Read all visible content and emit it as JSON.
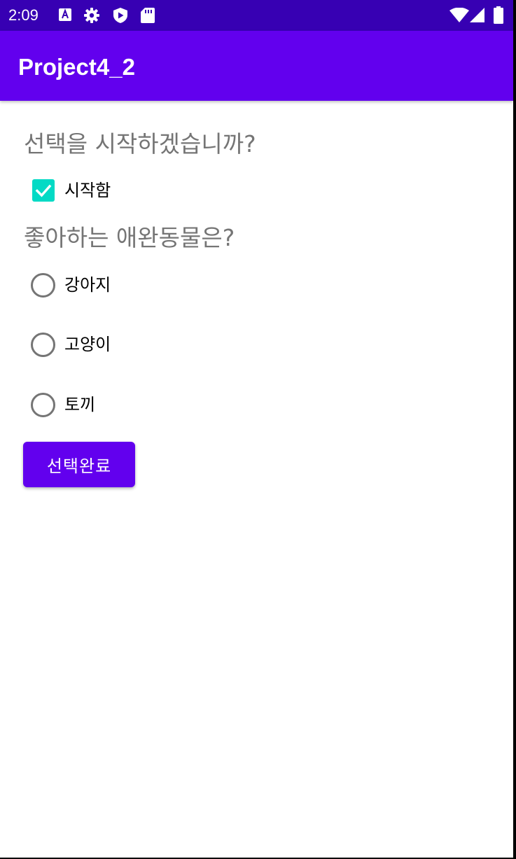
{
  "status_bar": {
    "time": "2:09",
    "left_icons": [
      "accessibility-a-icon",
      "settings-gear-icon",
      "play-protect-icon",
      "sd-card-icon"
    ],
    "right_icons": [
      "wifi-icon",
      "cell-signal-icon",
      "battery-icon"
    ],
    "color": "#3700b3"
  },
  "app_bar": {
    "title": "Project4_2",
    "color": "#6200ee"
  },
  "content": {
    "question_start": "선택을 시작하겠습니까?",
    "start_checkbox": {
      "label": "시작함",
      "checked": true,
      "color": "#03dac5"
    },
    "question_pet": "좋아하는 애완동물은?",
    "pet_options": [
      {
        "label": "강아지",
        "selected": false
      },
      {
        "label": "고양이",
        "selected": false
      },
      {
        "label": "토끼",
        "selected": false
      }
    ],
    "done_button": "선택완료"
  }
}
